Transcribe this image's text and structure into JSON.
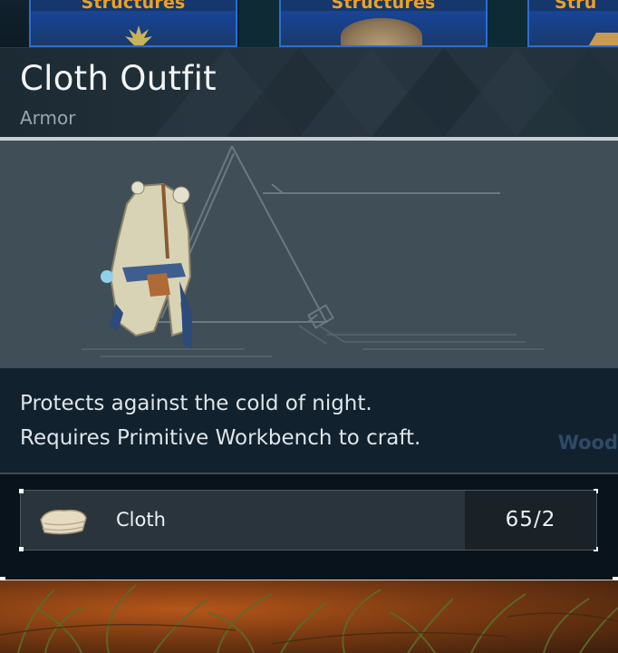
{
  "categories": [
    {
      "label": "Structures"
    },
    {
      "label": "Structures"
    },
    {
      "label": "Stru"
    }
  ],
  "item": {
    "name": "Cloth Outfit",
    "type": "Armor",
    "description_lines": [
      "Protects against the cold of night.",
      "Requires Primitive Workbench to craft."
    ]
  },
  "background_text": "Wood",
  "materials": [
    {
      "name": "Cloth",
      "count": "65/2",
      "icon": "cloth-icon"
    }
  ],
  "colors": {
    "category_label": "#f0a020",
    "category_tile": "#1a4aa0"
  }
}
